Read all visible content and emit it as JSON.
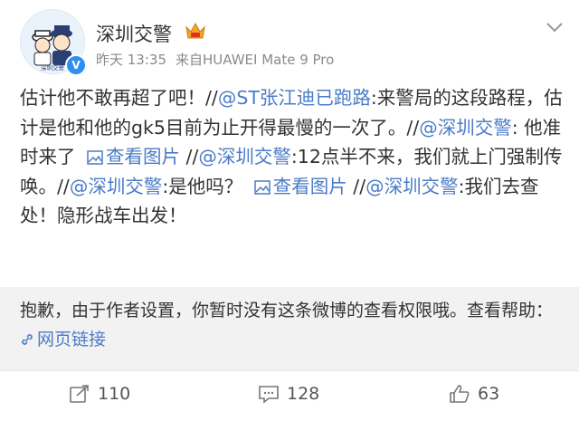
{
  "header": {
    "username": "深圳交警",
    "time": "昨天 13:35",
    "source": "来自HUAWEI Mate 9 Pro",
    "avatar_caption": "深圳交警"
  },
  "post": {
    "seg1": "估计他不敢再超了吧！//",
    "mention1": "@ST张江迪已跑路",
    "seg2": ":来警局的这段路程，估计是他和他的gk5目前为止开得最慢的一次了。//",
    "mention2": "@深圳交警",
    "seg3": ": 他准时来了 ",
    "pic1": "查看图片",
    "seg4": " //",
    "mention3": "@深圳交警",
    "seg5": ":12点半不来，我们就上门强制传唤。//",
    "mention4": "@深圳交警",
    "seg6": ":是他吗？ ",
    "pic2": "查看图片",
    "seg7": " //",
    "mention5": "@深圳交警",
    "seg8": ":我们去查处！隐形战车出发！"
  },
  "retweet": {
    "notice": "抱歉，由于作者设置，你暂时没有这条微博的查看权限哦。查看帮助：",
    "help_link": "网页链接"
  },
  "actions": {
    "repost_count": "110",
    "comment_count": "128",
    "like_count": "63"
  },
  "colors": {
    "link": "#4b7cc7",
    "verified": "#2f8ff0",
    "retweet_bg": "#f2f2f2",
    "crown": "#f5a623"
  }
}
